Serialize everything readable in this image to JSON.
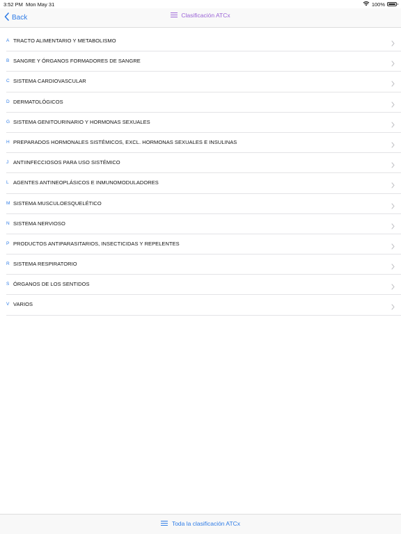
{
  "status_bar": {
    "time": "3:52 PM",
    "date": "Mon May 31",
    "battery_text": "100%",
    "wifi_icon": "wifi-icon",
    "battery_icon": "battery-icon",
    "battery_level": 1.0
  },
  "nav": {
    "back_label": "Back",
    "back_icon": "chevron-left-icon",
    "title": "Clasificación ATCx",
    "title_icon": "list-icon",
    "accent_color": "#2f7ce6",
    "title_color": "#9a63d6"
  },
  "categories": [
    {
      "code": "A",
      "label": "TRACTO ALIMENTARIO Y METABOLISMO"
    },
    {
      "code": "B",
      "label": "SANGRE Y ÓRGANOS FORMADORES DE SANGRE"
    },
    {
      "code": "C",
      "label": "SISTEMA CARDIOVASCULAR"
    },
    {
      "code": "D",
      "label": "DERMATOLÓGICOS"
    },
    {
      "code": "G",
      "label": "SISTEMA GENITOURINARIO Y HORMONAS SEXUALES"
    },
    {
      "code": "H",
      "label": "PREPARADOS HORMONALES SISTÉMICOS, EXCL. HORMONAS SEXUALES E INSULINAS"
    },
    {
      "code": "J",
      "label": "ANTIINFECCIOSOS PARA USO SISTÉMICO"
    },
    {
      "code": "L",
      "label": "AGENTES ANTINEOPLÁSICOS E INMUNOMODULADORES"
    },
    {
      "code": "M",
      "label": "SISTEMA MUSCULOESQUELÉTICO"
    },
    {
      "code": "N",
      "label": "SISTEMA NERVIOSO"
    },
    {
      "code": "P",
      "label": "PRODUCTOS ANTIPARASITARIOS, INSECTICIDAS Y REPELENTES"
    },
    {
      "code": "R",
      "label": "SISTEMA RESPIRATORIO"
    },
    {
      "code": "S",
      "label": "ÓRGANOS DE LOS SENTIDOS"
    },
    {
      "code": "V",
      "label": "VARIOS"
    }
  ],
  "bottom_bar": {
    "label": "Toda la clasificación ATCx",
    "icon": "list-icon"
  }
}
